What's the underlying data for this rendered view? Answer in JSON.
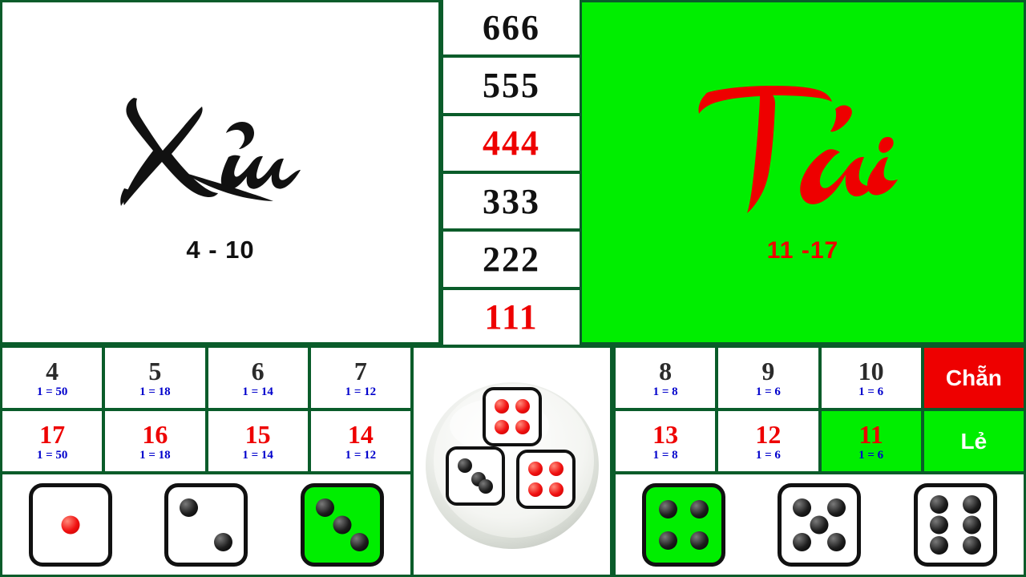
{
  "colors": {
    "board_border": "#0a5c2a",
    "bright_green": "#00ee00",
    "red": "#ee0000",
    "blue": "#0000cc",
    "black": "#111111",
    "white": "#ffffff"
  },
  "xiu_panel": {
    "label": "Xỉu",
    "range": "4 - 10"
  },
  "tai_panel": {
    "label": "Tài",
    "range": "11 -17"
  },
  "triples": [
    {
      "value": "666",
      "color": "black"
    },
    {
      "value": "555",
      "color": "black"
    },
    {
      "value": "444",
      "color": "red"
    },
    {
      "value": "333",
      "color": "black"
    },
    {
      "value": "222",
      "color": "black"
    },
    {
      "value": "111",
      "color": "red"
    }
  ],
  "bets_left": [
    {
      "num": "4",
      "odds": "1 = 50",
      "color": "black",
      "highlight": false
    },
    {
      "num": "5",
      "odds": "1 = 18",
      "color": "black",
      "highlight": false
    },
    {
      "num": "6",
      "odds": "1 = 14",
      "color": "black",
      "highlight": false
    },
    {
      "num": "7",
      "odds": "1 = 12",
      "color": "black",
      "highlight": false
    },
    {
      "num": "17",
      "odds": "1 = 50",
      "color": "red",
      "highlight": false
    },
    {
      "num": "16",
      "odds": "1 = 18",
      "color": "red",
      "highlight": false
    },
    {
      "num": "15",
      "odds": "1 = 14",
      "color": "red",
      "highlight": false
    },
    {
      "num": "14",
      "odds": "1 = 12",
      "color": "red",
      "highlight": false
    }
  ],
  "bets_right": [
    {
      "num": "8",
      "odds": "1 = 8",
      "color": "black",
      "highlight": false
    },
    {
      "num": "9",
      "odds": "1 = 6",
      "color": "black",
      "highlight": false
    },
    {
      "num": "10",
      "odds": "1 = 6",
      "color": "black",
      "highlight": false
    },
    {
      "num": "13",
      "odds": "1 = 8",
      "color": "red",
      "highlight": false
    },
    {
      "num": "12",
      "odds": "1 = 6",
      "color": "red",
      "highlight": false
    },
    {
      "num": "11",
      "odds": "1 = 6",
      "color": "red",
      "highlight": true
    }
  ],
  "parity": {
    "even_label": "Chẵn",
    "odd_label": "Lẻ"
  },
  "bowl": {
    "dice": [
      {
        "face": 4,
        "pip_color": "red",
        "position": "top"
      },
      {
        "face": 3,
        "pip_color": "black",
        "position": "bottom-left"
      },
      {
        "face": 4,
        "pip_color": "red",
        "position": "bottom-right"
      }
    ],
    "total": 11
  },
  "dice_row_left": [
    {
      "face": 1,
      "pip_color": "red",
      "highlight": false
    },
    {
      "face": 2,
      "pip_color": "black",
      "highlight": false
    },
    {
      "face": 3,
      "pip_color": "black",
      "highlight": true
    }
  ],
  "dice_row_right": [
    {
      "face": 4,
      "pip_color": "black",
      "highlight": true
    },
    {
      "face": 5,
      "pip_color": "black",
      "highlight": false
    },
    {
      "face": 6,
      "pip_color": "black",
      "highlight": false
    }
  ]
}
